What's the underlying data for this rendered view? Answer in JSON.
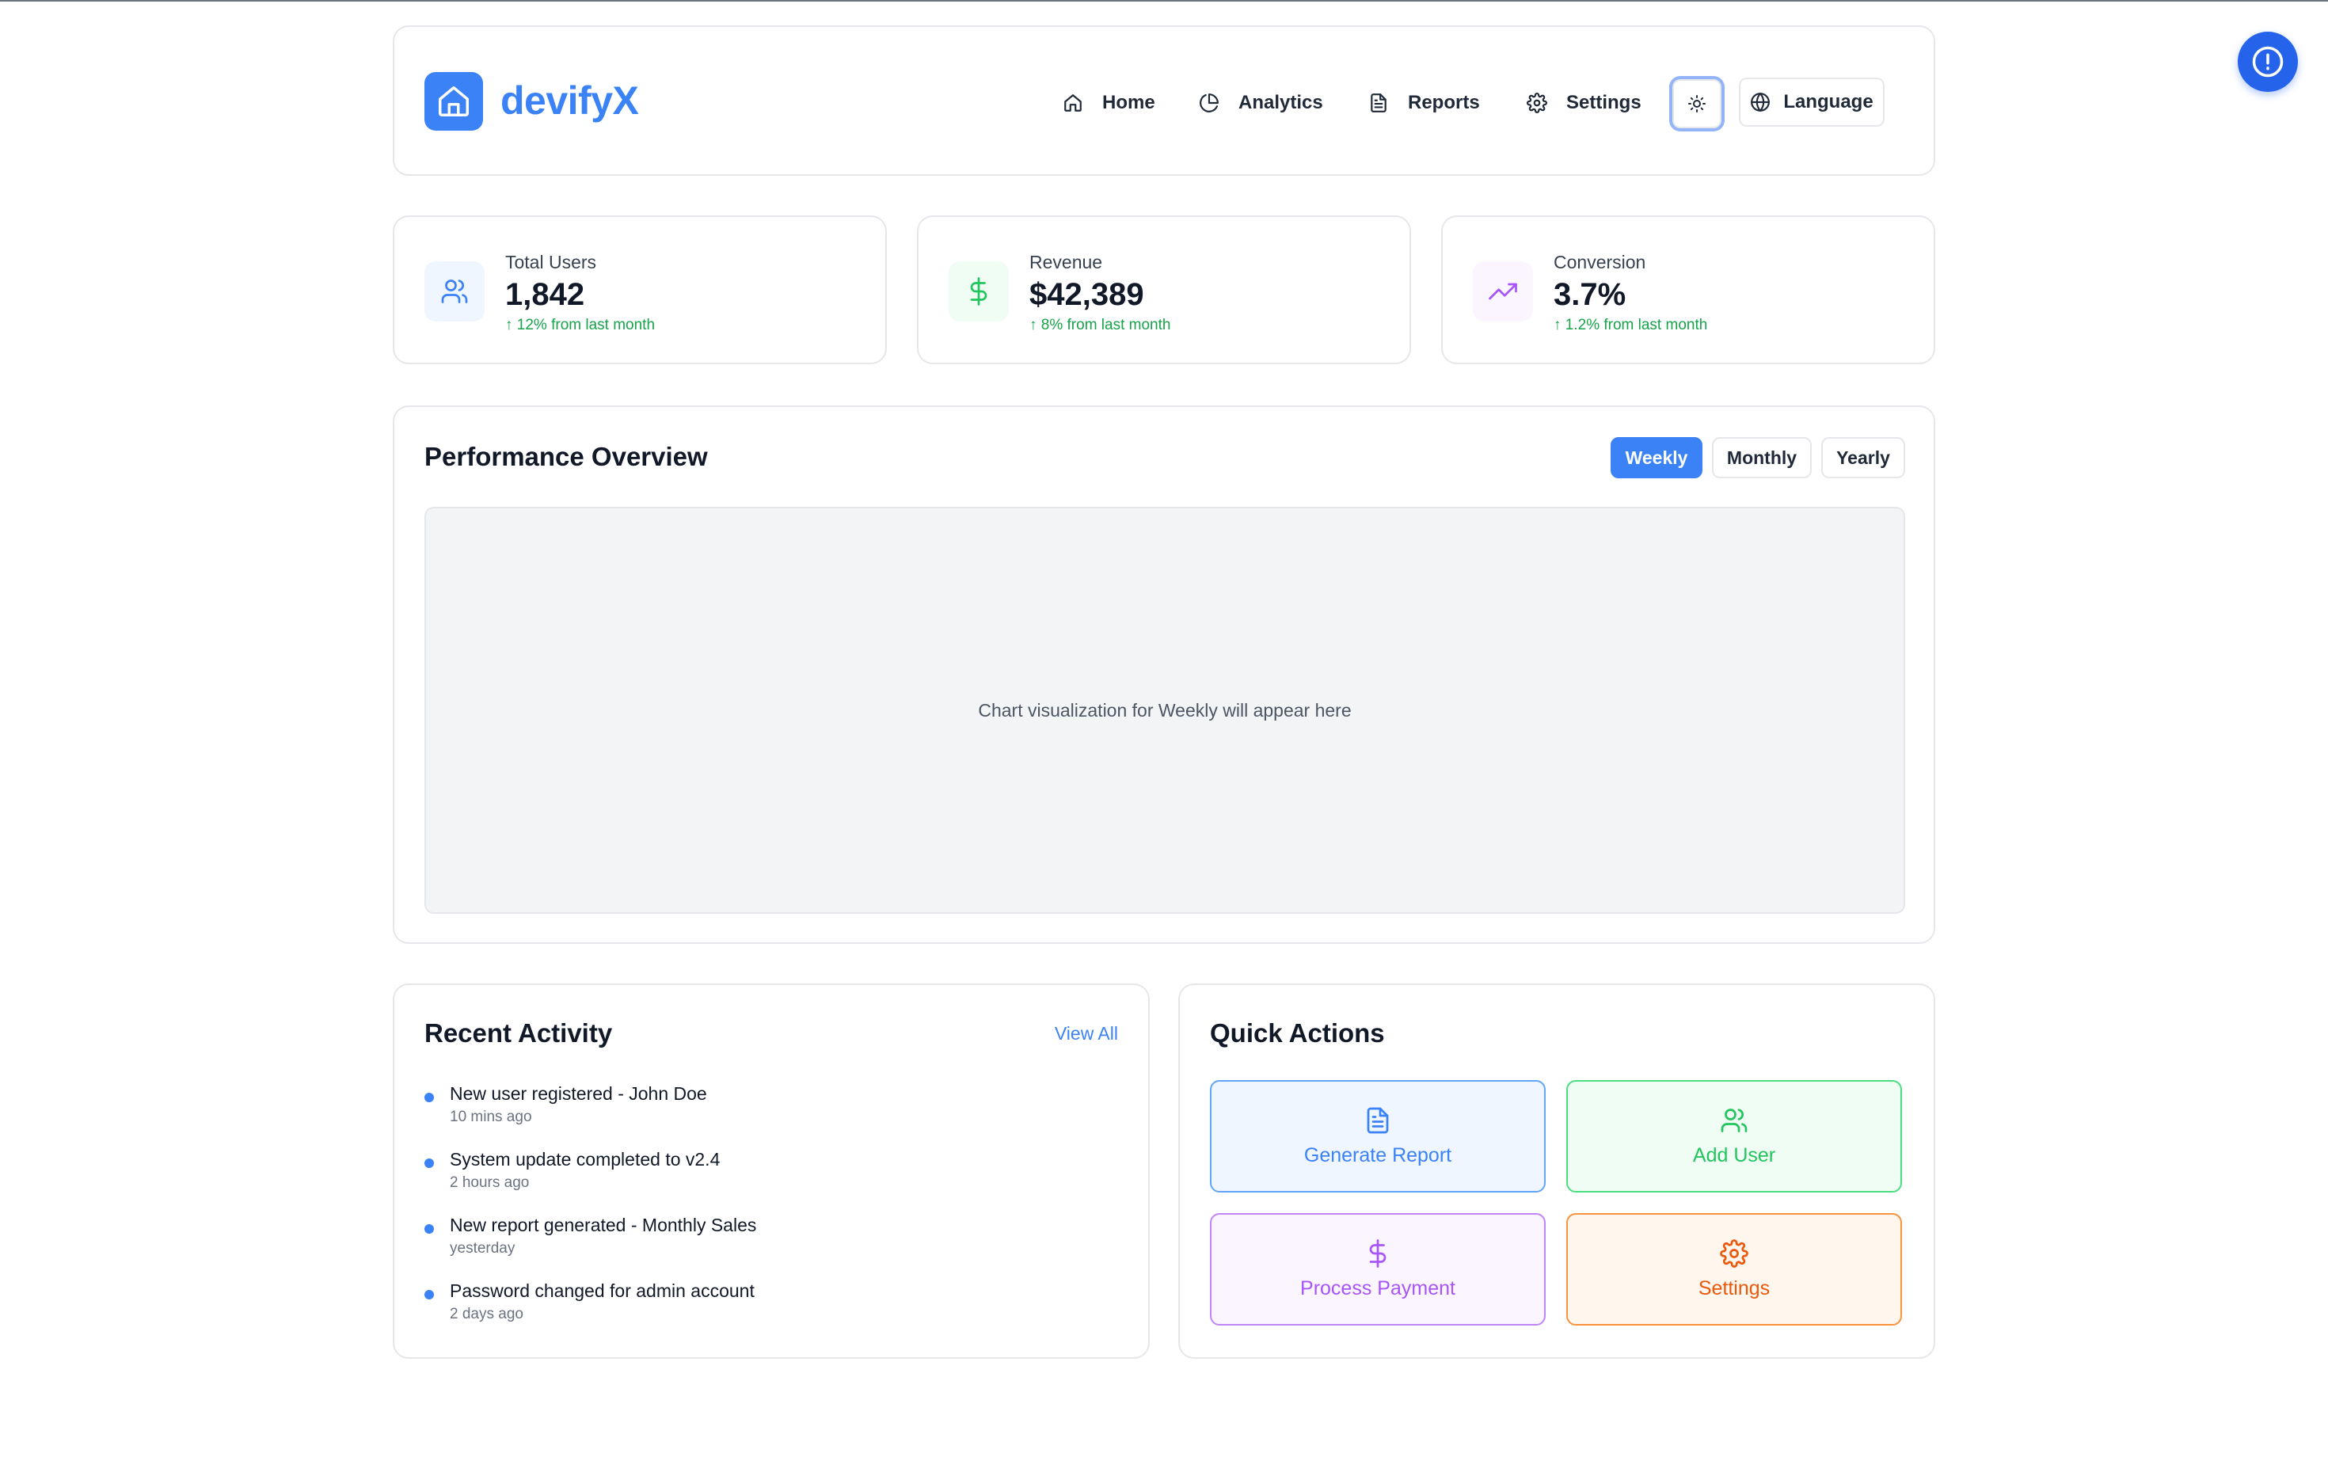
{
  "header": {
    "brand": "devifyX",
    "nav": [
      {
        "label": "Home",
        "icon": "home-icon"
      },
      {
        "label": "Analytics",
        "icon": "pie-chart-icon"
      },
      {
        "label": "Reports",
        "icon": "file-text-icon"
      },
      {
        "label": "Settings",
        "icon": "gear-icon"
      }
    ],
    "theme_toggle_icon": "sun-icon",
    "language_label": "Language"
  },
  "stats": [
    {
      "label": "Total Users",
      "value": "1,842",
      "change": "↑ 12% from last month",
      "icon": "users-icon",
      "color": "#3b82f6"
    },
    {
      "label": "Revenue",
      "value": "$42,389",
      "change": "↑ 8% from last month",
      "icon": "dollar-icon",
      "color": "#22c55e"
    },
    {
      "label": "Conversion",
      "value": "3.7%",
      "change": "↑ 1.2% from last month",
      "icon": "trending-up-icon",
      "color": "#a855f7"
    }
  ],
  "performance": {
    "title": "Performance Overview",
    "tabs": [
      "Weekly",
      "Monthly",
      "Yearly"
    ],
    "active_tab": "Weekly",
    "placeholder": "Chart visualization for Weekly will appear here"
  },
  "activity": {
    "title": "Recent Activity",
    "view_all": "View All",
    "items": [
      {
        "text": "New user registered - John Doe",
        "time": "10 mins ago"
      },
      {
        "text": "System update completed to v2.4",
        "time": "2 hours ago"
      },
      {
        "text": "New report generated - Monthly Sales",
        "time": "yesterday"
      },
      {
        "text": "Password changed for admin account",
        "time": "2 days ago"
      }
    ]
  },
  "quick_actions": {
    "title": "Quick Actions",
    "items": [
      {
        "label": "Generate Report",
        "icon": "file-text-icon",
        "color": "#3b82f6"
      },
      {
        "label": "Add User",
        "icon": "users-icon",
        "color": "#22c55e"
      },
      {
        "label": "Process Payment",
        "icon": "dollar-icon",
        "color": "#a855f7"
      },
      {
        "label": "Settings",
        "icon": "gear-icon",
        "color": "#f97316"
      }
    ]
  },
  "fab_icon": "alert-circle-icon",
  "colors": {
    "accent": "#3b82f6",
    "positive": "#16a34a"
  }
}
